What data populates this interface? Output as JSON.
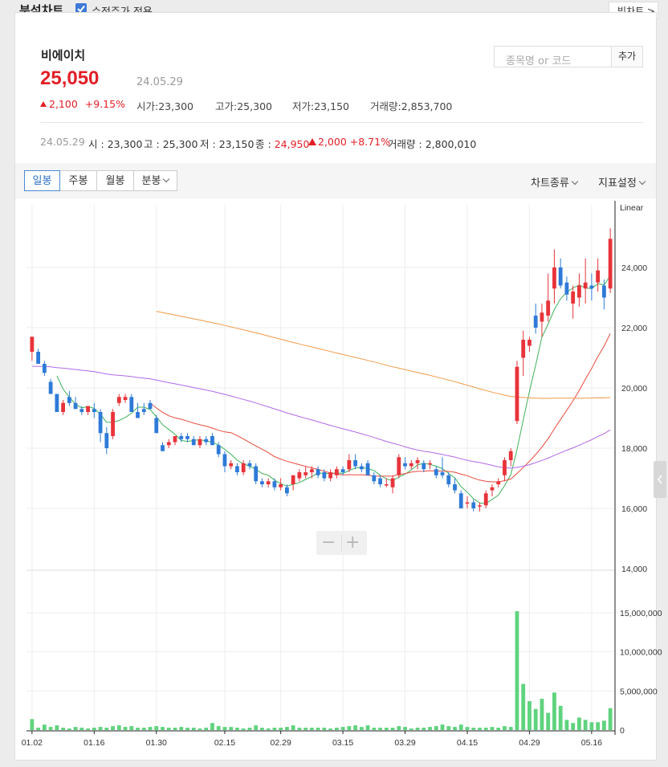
{
  "header": {
    "title": "분석차트",
    "adjusted_price_label": "수정주가 적용",
    "adjusted_price_checked": true,
    "big_chart_label": "빅차트 >"
  },
  "stock": {
    "name": "비에이치",
    "price": "25,050",
    "date": "24.05.29",
    "change": "2,100",
    "change_pct": "+9.15%",
    "open_label": "시가",
    "open": "23,300",
    "high_label": "고가",
    "high": "25,300",
    "low_label": "저가",
    "low": "23,150",
    "volume_label": "거래량",
    "volume": "2,853,700"
  },
  "search": {
    "placeholder": "종목명 or 코드",
    "add_label": "추가"
  },
  "daily": {
    "date": "24.05.29",
    "o_label": "시",
    "o": "23,300",
    "h_label": "고",
    "h": "25,300",
    "l_label": "저",
    "l": "23,150",
    "c_label": "종",
    "c": "24,950",
    "chg": "2,000",
    "chg_pct": "+8.71%",
    "vol_label": "거래량",
    "vol": "2,800,010"
  },
  "tabs": [
    "일봉",
    "주봉",
    "월봉",
    "분봉"
  ],
  "active_tab": "일봉",
  "chart_type_label": "차트종류",
  "indicator_label": "지표설정",
  "colors": {
    "up": "#e8333a",
    "down": "#2e7ad8",
    "accent": "#e21f26",
    "volume": "#5fd37e",
    "ma5": "#3fb25a",
    "ma20": "#e84a3c",
    "ma60": "#b06ae8",
    "ma120": "#ef9a46"
  },
  "chart_data": {
    "type": "candlestick",
    "scale_label": "Linear",
    "x_ticks": [
      "01.02",
      "01.16",
      "01.30",
      "02.15",
      "02.29",
      "03.15",
      "03.29",
      "04.15",
      "04.29",
      "05.16"
    ],
    "y_ticks": [
      "24,000",
      "22,000",
      "20,000",
      "18,000",
      "16,000",
      "14,000"
    ],
    "ylim": [
      14000,
      25500
    ],
    "volume_ticks": [
      "15,000,000",
      "10,000,000",
      "5,000,000",
      "0"
    ],
    "volume_ylim": [
      0,
      15000000
    ],
    "candles": [
      {
        "o": 21200,
        "h": 21600,
        "l": 20900,
        "c": 21700
      },
      {
        "o": 21200,
        "h": 21300,
        "l": 20800,
        "c": 20800
      },
      {
        "o": 20800,
        "h": 20900,
        "l": 20400,
        "c": 20500
      },
      {
        "o": 20200,
        "h": 20300,
        "l": 19800,
        "c": 19800
      },
      {
        "o": 19800,
        "h": 19800,
        "l": 19200,
        "c": 19200
      },
      {
        "o": 19200,
        "h": 19600,
        "l": 19100,
        "c": 19500
      },
      {
        "o": 19700,
        "h": 19900,
        "l": 19400,
        "c": 19500
      },
      {
        "o": 19500,
        "h": 19700,
        "l": 19300,
        "c": 19300
      },
      {
        "o": 19300,
        "h": 19400,
        "l": 19100,
        "c": 19200
      },
      {
        "o": 19200,
        "h": 19400,
        "l": 19100,
        "c": 19400
      },
      {
        "o": 19300,
        "h": 19500,
        "l": 19000,
        "c": 19200
      },
      {
        "o": 19200,
        "h": 19300,
        "l": 18200,
        "c": 18500
      },
      {
        "o": 18500,
        "h": 18700,
        "l": 17800,
        "c": 18000
      },
      {
        "o": 18400,
        "h": 19300,
        "l": 18300,
        "c": 19200
      },
      {
        "o": 19500,
        "h": 19800,
        "l": 19400,
        "c": 19700
      },
      {
        "o": 19600,
        "h": 19800,
        "l": 19500,
        "c": 19700
      },
      {
        "o": 19700,
        "h": 19800,
        "l": 19200,
        "c": 19200
      },
      {
        "o": 19200,
        "h": 19500,
        "l": 19000,
        "c": 19000
      },
      {
        "o": 19300,
        "h": 19500,
        "l": 19100,
        "c": 19200
      },
      {
        "o": 19500,
        "h": 19600,
        "l": 19300,
        "c": 19300
      },
      {
        "o": 19000,
        "h": 19100,
        "l": 18500,
        "c": 18500
      },
      {
        "o": 18100,
        "h": 18200,
        "l": 17900,
        "c": 17900
      },
      {
        "o": 18100,
        "h": 18300,
        "l": 18000,
        "c": 18200
      },
      {
        "o": 18200,
        "h": 18400,
        "l": 18100,
        "c": 18400
      },
      {
        "o": 18400,
        "h": 18500,
        "l": 18200,
        "c": 18300
      },
      {
        "o": 18400,
        "h": 18500,
        "l": 18200,
        "c": 18300
      },
      {
        "o": 18300,
        "h": 18400,
        "l": 18100,
        "c": 18100
      },
      {
        "o": 18100,
        "h": 18400,
        "l": 18000,
        "c": 18300
      },
      {
        "o": 18300,
        "h": 18400,
        "l": 18100,
        "c": 18200
      },
      {
        "o": 18400,
        "h": 18500,
        "l": 18100,
        "c": 18100
      },
      {
        "o": 18100,
        "h": 18200,
        "l": 17700,
        "c": 17800
      },
      {
        "o": 17800,
        "h": 17900,
        "l": 17200,
        "c": 17400
      },
      {
        "o": 17400,
        "h": 17600,
        "l": 17300,
        "c": 17500
      },
      {
        "o": 17400,
        "h": 17500,
        "l": 17100,
        "c": 17200
      },
      {
        "o": 17200,
        "h": 17600,
        "l": 17100,
        "c": 17500
      },
      {
        "o": 17500,
        "h": 17600,
        "l": 17300,
        "c": 17400
      },
      {
        "o": 17400,
        "h": 17500,
        "l": 16800,
        "c": 16900
      },
      {
        "o": 16900,
        "h": 17000,
        "l": 16700,
        "c": 16800
      },
      {
        "o": 16800,
        "h": 17000,
        "l": 16700,
        "c": 16900
      },
      {
        "o": 16900,
        "h": 17000,
        "l": 16600,
        "c": 16700
      },
      {
        "o": 16700,
        "h": 17000,
        "l": 16600,
        "c": 16800
      },
      {
        "o": 16700,
        "h": 16800,
        "l": 16400,
        "c": 16500
      },
      {
        "o": 16800,
        "h": 17100,
        "l": 16600,
        "c": 17100
      },
      {
        "o": 17000,
        "h": 17300,
        "l": 16900,
        "c": 17200
      },
      {
        "o": 17100,
        "h": 17400,
        "l": 17000,
        "c": 17200
      },
      {
        "o": 17200,
        "h": 17400,
        "l": 17000,
        "c": 17300
      },
      {
        "o": 17300,
        "h": 17400,
        "l": 17000,
        "c": 17100
      },
      {
        "o": 17200,
        "h": 17300,
        "l": 16900,
        "c": 17000
      },
      {
        "o": 17000,
        "h": 17300,
        "l": 16900,
        "c": 17200
      },
      {
        "o": 17100,
        "h": 17400,
        "l": 17000,
        "c": 17300
      },
      {
        "o": 17300,
        "h": 17400,
        "l": 17100,
        "c": 17200
      },
      {
        "o": 17300,
        "h": 17800,
        "l": 17200,
        "c": 17600
      },
      {
        "o": 17600,
        "h": 17800,
        "l": 17300,
        "c": 17400
      },
      {
        "o": 17400,
        "h": 17500,
        "l": 17200,
        "c": 17300
      },
      {
        "o": 17500,
        "h": 17600,
        "l": 17100,
        "c": 17100
      },
      {
        "o": 17100,
        "h": 17200,
        "l": 16800,
        "c": 16900
      },
      {
        "o": 17000,
        "h": 17100,
        "l": 16700,
        "c": 16800
      },
      {
        "o": 16800,
        "h": 17000,
        "l": 16700,
        "c": 16800
      },
      {
        "o": 16700,
        "h": 17100,
        "l": 16500,
        "c": 17000
      },
      {
        "o": 17100,
        "h": 17800,
        "l": 17000,
        "c": 17700
      },
      {
        "o": 17500,
        "h": 17700,
        "l": 17300,
        "c": 17400
      },
      {
        "o": 17400,
        "h": 17600,
        "l": 17300,
        "c": 17500
      },
      {
        "o": 17500,
        "h": 17700,
        "l": 17300,
        "c": 17600
      },
      {
        "o": 17500,
        "h": 17600,
        "l": 17200,
        "c": 17300
      },
      {
        "o": 17500,
        "h": 17600,
        "l": 17300,
        "c": 17500
      },
      {
        "o": 17300,
        "h": 17400,
        "l": 17000,
        "c": 17100
      },
      {
        "o": 17200,
        "h": 17700,
        "l": 17000,
        "c": 17100
      },
      {
        "o": 17100,
        "h": 17200,
        "l": 16700,
        "c": 16800
      },
      {
        "o": 16800,
        "h": 17000,
        "l": 16500,
        "c": 16600
      },
      {
        "o": 16500,
        "h": 16600,
        "l": 16000,
        "c": 16000
      },
      {
        "o": 16200,
        "h": 16400,
        "l": 16000,
        "c": 16200
      },
      {
        "o": 16200,
        "h": 16300,
        "l": 15900,
        "c": 16000
      },
      {
        "o": 16100,
        "h": 16200,
        "l": 15900,
        "c": 16100
      },
      {
        "o": 16100,
        "h": 16600,
        "l": 16000,
        "c": 16500
      },
      {
        "o": 16600,
        "h": 16800,
        "l": 16400,
        "c": 16700
      },
      {
        "o": 16800,
        "h": 17000,
        "l": 16700,
        "c": 16900
      },
      {
        "o": 17100,
        "h": 17700,
        "l": 16900,
        "c": 17600
      },
      {
        "o": 17600,
        "h": 18000,
        "l": 17400,
        "c": 17900
      },
      {
        "o": 18900,
        "h": 20900,
        "l": 18800,
        "c": 20700
      },
      {
        "o": 21000,
        "h": 21900,
        "l": 20400,
        "c": 21600
      },
      {
        "o": 21400,
        "h": 21700,
        "l": 21200,
        "c": 21600
      },
      {
        "o": 22400,
        "h": 22800,
        "l": 21800,
        "c": 22000
      },
      {
        "o": 22200,
        "h": 22800,
        "l": 21700,
        "c": 22500
      },
      {
        "o": 22400,
        "h": 23800,
        "l": 22200,
        "c": 22900
      },
      {
        "o": 23300,
        "h": 24600,
        "l": 22800,
        "c": 24000
      },
      {
        "o": 24000,
        "h": 24300,
        "l": 23300,
        "c": 23400
      },
      {
        "o": 23500,
        "h": 23700,
        "l": 22900,
        "c": 23100
      },
      {
        "o": 22800,
        "h": 23400,
        "l": 22300,
        "c": 23200
      },
      {
        "o": 23000,
        "h": 23800,
        "l": 22700,
        "c": 23400
      },
      {
        "o": 23300,
        "h": 24300,
        "l": 22800,
        "c": 23500
      },
      {
        "o": 23400,
        "h": 23800,
        "l": 22900,
        "c": 23300
      },
      {
        "o": 23500,
        "h": 24300,
        "l": 23200,
        "c": 23900
      },
      {
        "o": 23400,
        "h": 23600,
        "l": 22600,
        "c": 23000
      },
      {
        "o": 23300,
        "h": 25300,
        "l": 23150,
        "c": 24950
      }
    ],
    "volumes": [
      1400000,
      300000,
      700000,
      400000,
      600000,
      300000,
      200000,
      400000,
      300000,
      200000,
      300000,
      400000,
      300000,
      500000,
      600000,
      400000,
      500000,
      300000,
      300000,
      400000,
      500000,
      400000,
      300000,
      300000,
      400000,
      300000,
      300000,
      200000,
      300000,
      900000,
      500000,
      400000,
      400000,
      300000,
      200000,
      300000,
      600000,
      300000,
      200000,
      300000,
      300000,
      400000,
      600000,
      300000,
      300000,
      300000,
      300000,
      300000,
      200000,
      300000,
      400000,
      500000,
      600000,
      400000,
      600000,
      300000,
      300000,
      300000,
      300000,
      500000,
      400000,
      200000,
      300000,
      300000,
      400000,
      500000,
      700000,
      500000,
      400000,
      700000,
      400000,
      300000,
      300000,
      300000,
      400000,
      300000,
      500000,
      400000,
      15200000,
      5900000,
      3700000,
      2700000,
      4000000,
      2200000,
      4800000,
      3100000,
      1300000,
      900000,
      1600000,
      1300000,
      1000000,
      1000000,
      1200000,
      2800000
    ]
  }
}
